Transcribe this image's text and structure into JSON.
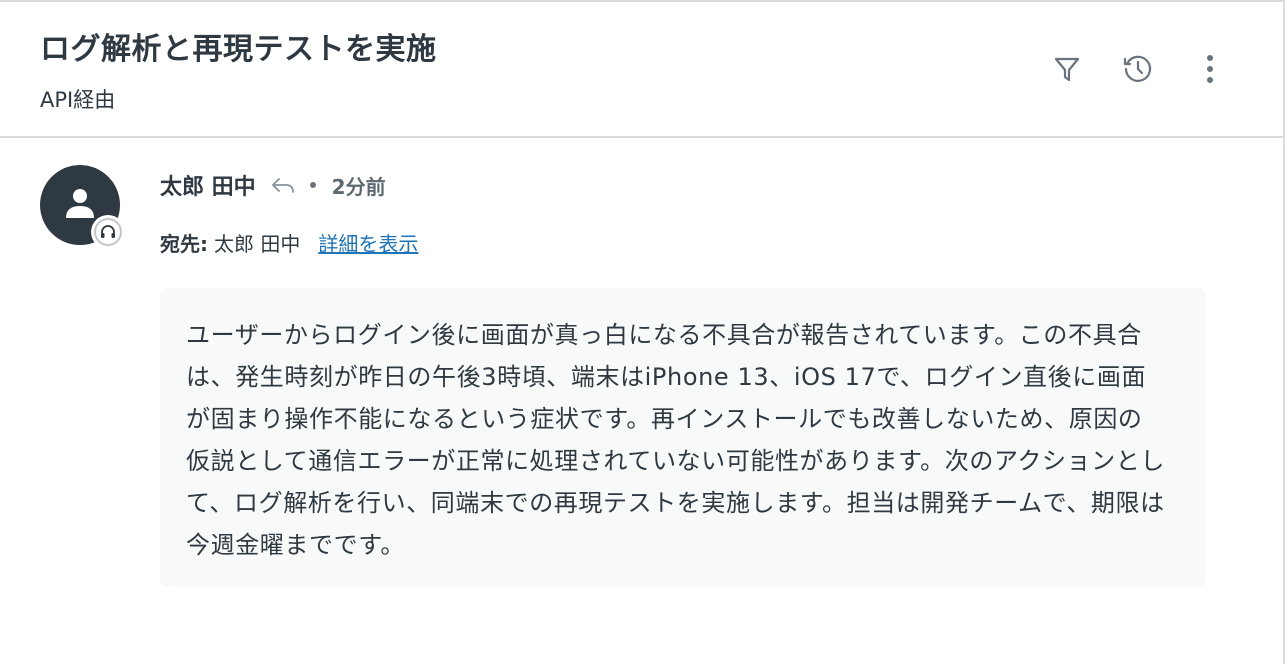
{
  "ticket": {
    "title": "ログ解析と再現テストを実施",
    "channel": "API経由"
  },
  "toolbar": {
    "icons": [
      "filter-icon",
      "history-icon",
      "more-vertical-icon"
    ]
  },
  "comment": {
    "author": "太郎 田中",
    "timestamp": "2分前",
    "recipient_label": "宛先:",
    "recipient": "太郎 田中",
    "details_link": "詳細を表示",
    "body": "ユーザーからログイン後に画面が真っ白になる不具合が報告されています。この不具合は、発生時刻が昨日の午後3時頃、端末はiPhone 13、iOS 17で、ログイン直後に画面が固まり操作不能になるという症状です。再インストールでも改善しないため、原因の仮説として通信エラーが正常に処理されていない可能性があります。次のアクションとして、ログ解析を行い、同端末での再現テストを実施します。担当は開発チームで、期限は今週金曜までです。"
  },
  "colors": {
    "text": "#2f3941",
    "link": "#1f73b7",
    "avatar_bg": "#2f3941",
    "message_bg": "#f8f9f9",
    "border": "#d9dcde"
  }
}
